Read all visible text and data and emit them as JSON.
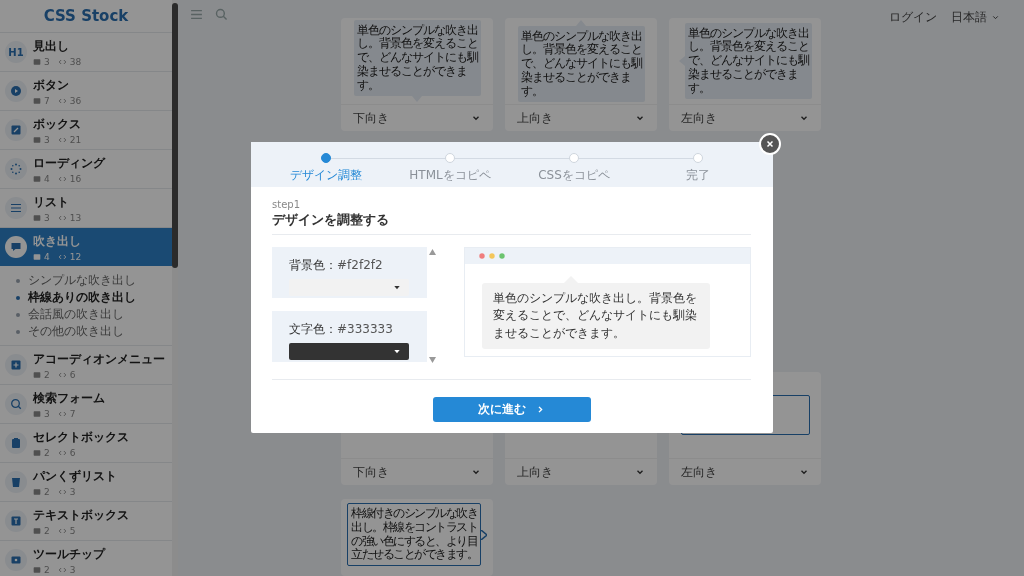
{
  "sidebar": {
    "logo": "CSS Stock",
    "icon_text": "H1",
    "items": [
      {
        "title": "見出し",
        "count": "3",
        "code_count": "38",
        "selected": false,
        "expanded": false
      },
      {
        "title": "ボタン",
        "count": "7",
        "code_count": "36",
        "selected": false,
        "expanded": false
      },
      {
        "title": "ボックス",
        "count": "3",
        "code_count": "21",
        "selected": false,
        "expanded": false
      },
      {
        "title": "ローディング",
        "count": "4",
        "code_count": "16",
        "selected": false,
        "expanded": false
      },
      {
        "title": "リスト",
        "count": "3",
        "code_count": "13",
        "selected": false,
        "expanded": false
      },
      {
        "title": "吹き出し",
        "count": "4",
        "code_count": "12",
        "selected": true,
        "expanded": true,
        "children": [
          {
            "label": "シンプルな吹き出し",
            "selected": false
          },
          {
            "label": "枠線ありの吹き出し",
            "selected": true
          },
          {
            "label": "会話風の吹き出し",
            "selected": false
          },
          {
            "label": "その他の吹き出し",
            "selected": false
          }
        ]
      },
      {
        "title": "アコーディオンメニュー",
        "count": "2",
        "code_count": "6",
        "selected": false,
        "expanded": false
      },
      {
        "title": "検索フォーム",
        "count": "3",
        "code_count": "7",
        "selected": false,
        "expanded": false
      },
      {
        "title": "セレクトボックス",
        "count": "2",
        "code_count": "6",
        "selected": false,
        "expanded": false
      },
      {
        "title": "パンくずリスト",
        "count": "2",
        "code_count": "3",
        "selected": false,
        "expanded": false
      },
      {
        "title": "テキストボックス",
        "count": "2",
        "code_count": "5",
        "selected": false,
        "expanded": false
      },
      {
        "title": "ツールチップ",
        "count": "2",
        "code_count": "3",
        "selected": false,
        "expanded": false
      }
    ]
  },
  "toolbar": {
    "login": "ログイン",
    "language": "日本語"
  },
  "cards": {
    "rows": [
      [
        {
          "label": "下向き",
          "bubble": {
            "text": "単色のシンプルな吹き出し。背景色を変えることで、どんなサイトにも馴染ませることができます。",
            "kind": "down",
            "bordered": false
          }
        },
        {
          "label": "上向き",
          "bubble": {
            "text": "単色のシンプルな吹き出し。背景色を変えることで、どんなサイトにも馴染ませることができます。",
            "kind": "up",
            "bordered": false
          }
        },
        {
          "label": "左向き",
          "bubble": {
            "text": "単色のシンプルな吹き出し。背景色を変えることで、どんなサイトにも馴染ませることができます。",
            "kind": "left",
            "bordered": false
          }
        }
      ],
      [
        {
          "label": "下向き"
        },
        {
          "label": "上向き"
        },
        {
          "label": "左向き",
          "bubble": {
            "kind": "plain",
            "bordered": true
          }
        }
      ],
      [
        {
          "bubble": {
            "text": "枠線付きのシンプルな吹き出し。枠線をコントラストの強い色にすると、より目立たせることができます。",
            "kind": "right",
            "bordered": true
          }
        }
      ]
    ]
  },
  "modal": {
    "steps": [
      {
        "label": "デザイン調整",
        "selected": true
      },
      {
        "label": "HTMLをコピペ",
        "selected": false
      },
      {
        "label": "CSSをコピペ",
        "selected": false
      },
      {
        "label": "完了",
        "selected": false
      }
    ],
    "step_caption": "step1",
    "heading": "デザインを調整する",
    "settings": [
      {
        "label": "背景色：",
        "value": "#f2f2f2"
      },
      {
        "label": "文字色：",
        "value": "#333333"
      }
    ],
    "preview": {
      "text": "単色のシンプルな吹き出し。背景色を変えることで、どんなサイトにも馴染ませることができます。"
    },
    "next_button": "次に進む"
  }
}
